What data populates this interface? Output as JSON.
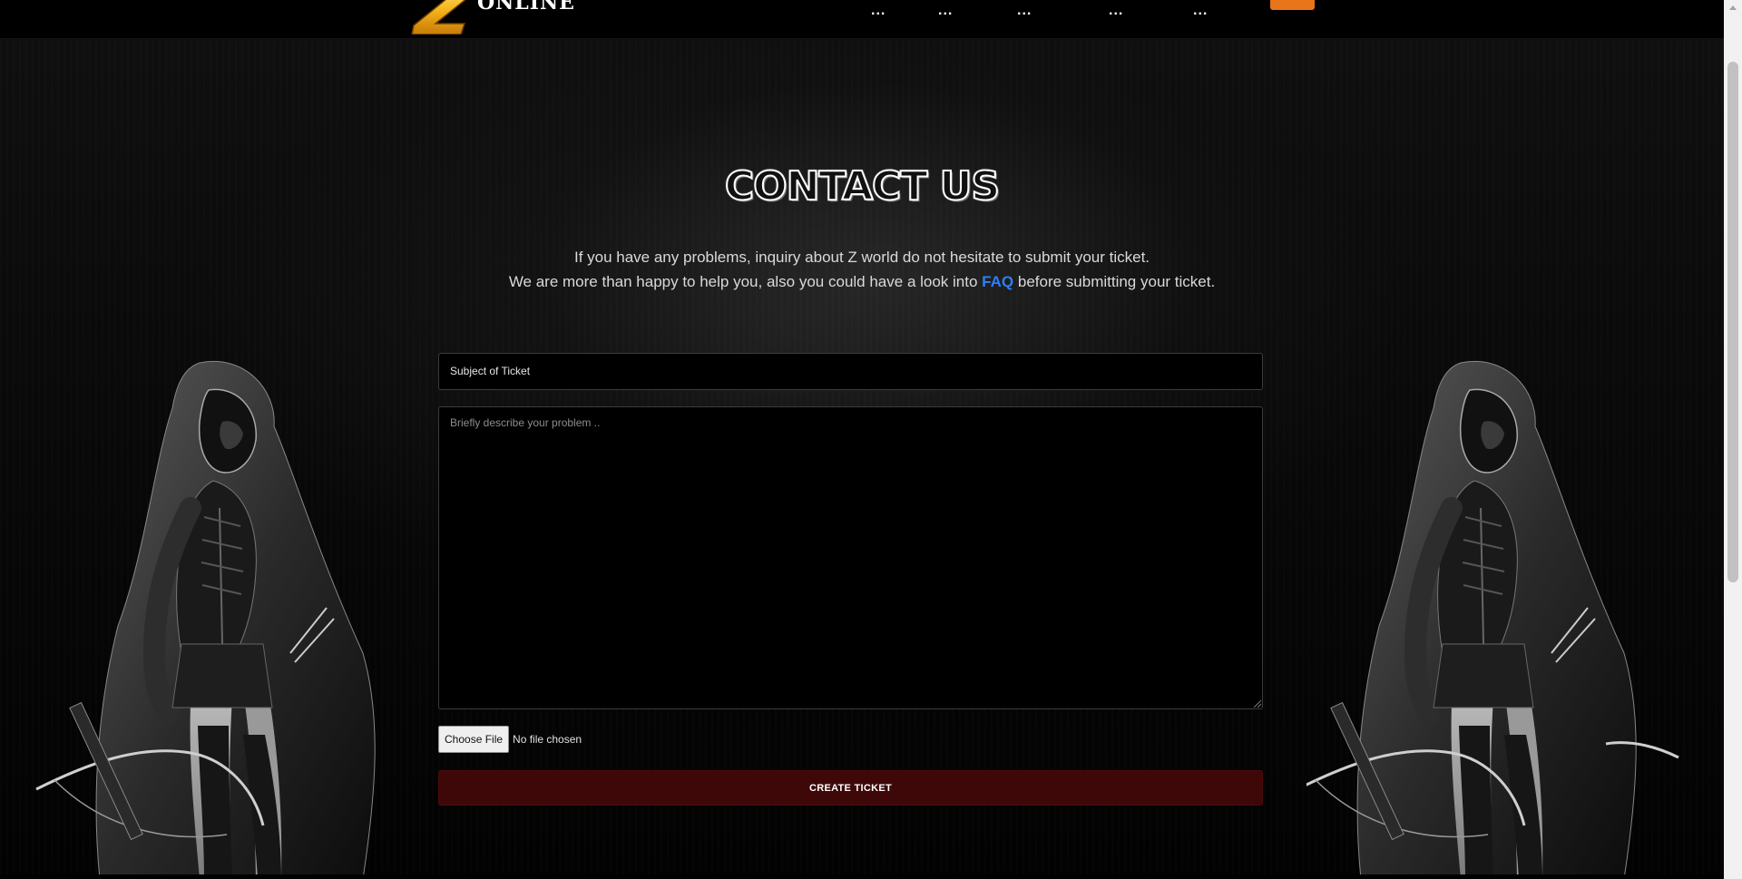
{
  "header": {
    "logo_text": "ONLINE",
    "logo_letter": "Z",
    "nav_items": [
      "...",
      "...",
      "...",
      "...",
      "..."
    ],
    "accent_color": "#e8751a"
  },
  "main": {
    "title": "CONTACT US",
    "intro_line1": "If you have any problems, inquiry about Z world do not hesitate to submit your ticket.",
    "intro_line2_before": "We are more than happy to help you, also you could have a look into",
    "faq_link": "FAQ",
    "intro_line2_after": "before submitting your ticket."
  },
  "form": {
    "subject_placeholder": "Subject of Ticket",
    "problem_placeholder": "Briefly describe your problem ..",
    "file_button": "Choose File",
    "file_status": "No file chosen",
    "submit_label": "CREATE TICKET",
    "submit_color": "#3e0708"
  },
  "icons": [
    "logo-icon",
    "character-illustration",
    "scrollbar"
  ]
}
